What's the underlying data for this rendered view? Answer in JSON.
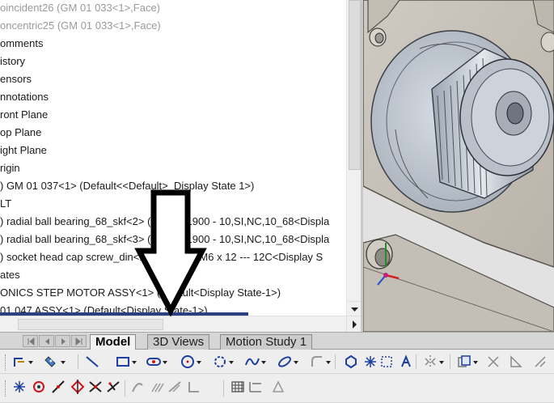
{
  "feature_tree": {
    "items": [
      {
        "text": "oincident26 (GM 01 033<1>,Face)",
        "dim": true
      },
      {
        "text": "oncentric25 (GM 01 033<1>,Face)",
        "dim": true
      },
      {
        "text": "omments",
        "dim": false
      },
      {
        "text": "istory",
        "dim": false
      },
      {
        "text": "ensors",
        "dim": false
      },
      {
        "text": "nnotations",
        "dim": false
      },
      {
        "text": "ront Plane",
        "dim": false
      },
      {
        "text": "op Plane",
        "dim": false
      },
      {
        "text": "ight Plane",
        "dim": false
      },
      {
        "text": "rigin",
        "dim": false
      },
      {
        "text": ") GM 01 037<1> (Default<<Default>_Display State 1>)",
        "dim": false
      },
      {
        "text": "LT",
        "dim": false
      },
      {
        "text": ") radial ball bearing_68_skf<2> (SKF - 61900 - 10,SI,NC,10_68<Displa",
        "dim": false
      },
      {
        "text": ") radial ball bearing_68_skf<3> (SKF - 61900 - 10,SI,NC,10_68<Displa",
        "dim": false
      },
      {
        "text": ") socket head cap screw_din<1> (DIN 912 M6 x 12 --- 12C<Display S",
        "dim": false
      },
      {
        "text": "ates",
        "dim": false
      },
      {
        "text": "ONICS STEP MOTOR ASSY<1> (Default<Display State-1>)",
        "dim": false
      },
      {
        "text": "01 047 ASSY<1> (Default<Display State-1>)",
        "dim": false
      }
    ]
  },
  "tabs": [
    {
      "label": "Model",
      "active": true
    },
    {
      "label": "3D Views",
      "active": false
    },
    {
      "label": "Motion Study 1",
      "active": false
    }
  ],
  "toolbar_top": [
    "smart-dimension-icon",
    "dimension-dropdown-icon",
    "line-icon",
    "rectangle-icon",
    "slot-icon",
    "circle-icon",
    "arc-icon",
    "spline-icon",
    "ellipse-icon",
    "fillet-icon",
    "polygon-icon",
    "point-icon",
    "construction-geometry-icon",
    "text-icon",
    "mirror-icon",
    "offset-icon",
    "trim-icon",
    "display-relations-icon",
    "repair-sketch-icon"
  ],
  "toolbar_bottom": [
    "point-icon",
    "center-point-icon",
    "midpoint-line-icon",
    "diamond-point-icon",
    "intersection-icon",
    "tangent-icon",
    "parallel-icon",
    "perpendicular-icon",
    "coincident-icon",
    "corner-icon",
    "grid-icon",
    "chart-icon",
    "angle-icon"
  ],
  "colors": {
    "selection": "#2b3f82",
    "viewport_bg": "#e2e2e2",
    "tab_active": "#f2f2f2",
    "toolbar_icon_blue": "#1c3fa0",
    "toolbar_icon_red": "#d1141a"
  }
}
